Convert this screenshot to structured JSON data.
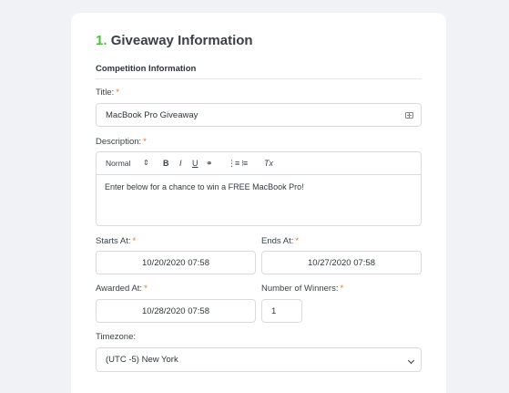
{
  "form": {
    "step_number": "1.",
    "heading": "Giveaway Information",
    "section": "Competition Information",
    "title_label": "Title:",
    "title_value": "MacBook Pro Giveaway",
    "description_label": "Description:",
    "toolbar": {
      "format": "Normal",
      "format_arrows": "⇕",
      "bold": "B",
      "italic": "I",
      "underline": "U",
      "link": "⚭",
      "ordered_list": "⋮≡",
      "bullet_list": "⁝≡",
      "clear": "Tx"
    },
    "description_value": "Enter below for a chance to win a FREE MacBook Pro!",
    "starts_label": "Starts At:",
    "starts_value": "10/20/2020 07:58",
    "ends_label": "Ends At:",
    "ends_value": "10/27/2020 07:58",
    "awarded_label": "Awarded At:",
    "awarded_value": "10/28/2020 07:58",
    "winners_label": "Number of Winners:",
    "winners_value": "1",
    "timezone_label": "Timezone:",
    "timezone_value": "(UTC -5) New York",
    "required_mark": "*"
  },
  "colors": {
    "accent_green": "#4dbd3e",
    "required_orange": "#f2711c",
    "background": "#f1f2f5"
  }
}
